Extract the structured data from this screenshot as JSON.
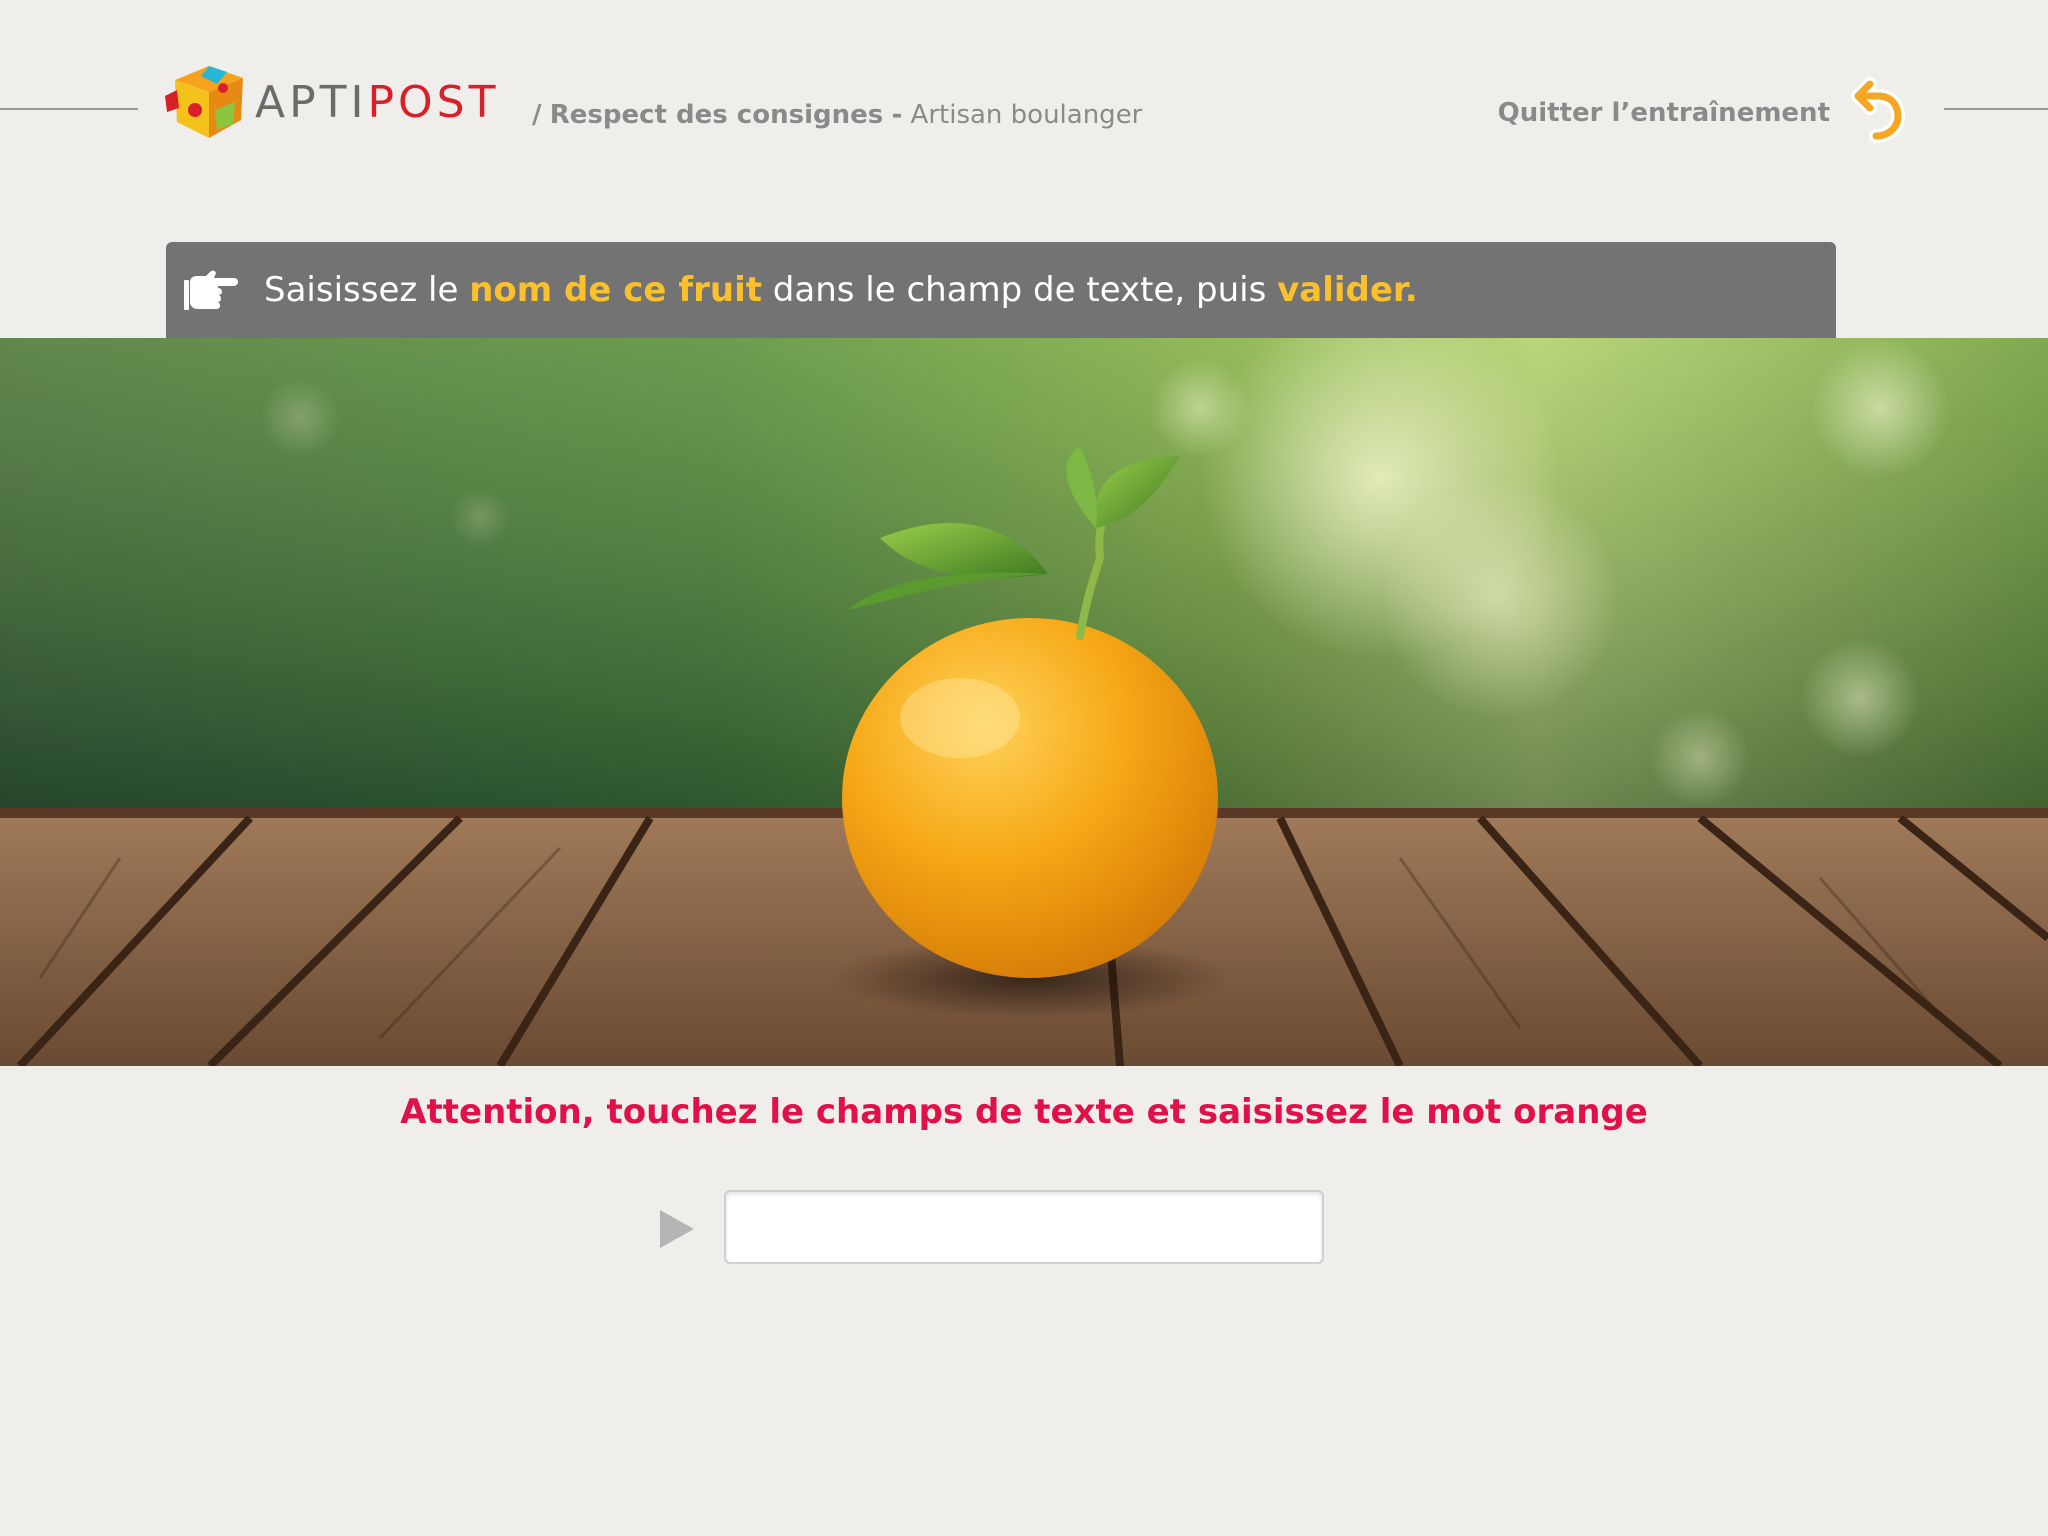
{
  "header": {
    "logo": {
      "text_first": "APTI",
      "text_second": "POST",
      "icon": "puzzle-cube-icon"
    },
    "breadcrumb": {
      "separator": "/",
      "section": "Respect des consignes",
      "dash": "-",
      "job": "Artisan boulanger"
    },
    "quit": {
      "label": "Quitter l’entraînement",
      "icon": "undo-arrow-icon"
    }
  },
  "instruction": {
    "icon": "pointing-hand-icon",
    "part1": "Saisissez le ",
    "highlight1": "nom de ce fruit",
    "part2": " dans le champ de texte, puis ",
    "highlight2": "valider."
  },
  "hero_image": {
    "subject": "orange-fruit-image"
  },
  "warning": {
    "text": "Attention, touchez le champs de texte et saisissez le mot orange"
  },
  "answer": {
    "value": "",
    "placeholder": "",
    "icon": "play-arrow-icon"
  },
  "colors": {
    "background": "#efeeea",
    "banner": "#737373",
    "highlight": "#fbc02d",
    "warning": "#e01048",
    "brand_red": "#d8202a",
    "quit_icon": "#f5a623"
  }
}
